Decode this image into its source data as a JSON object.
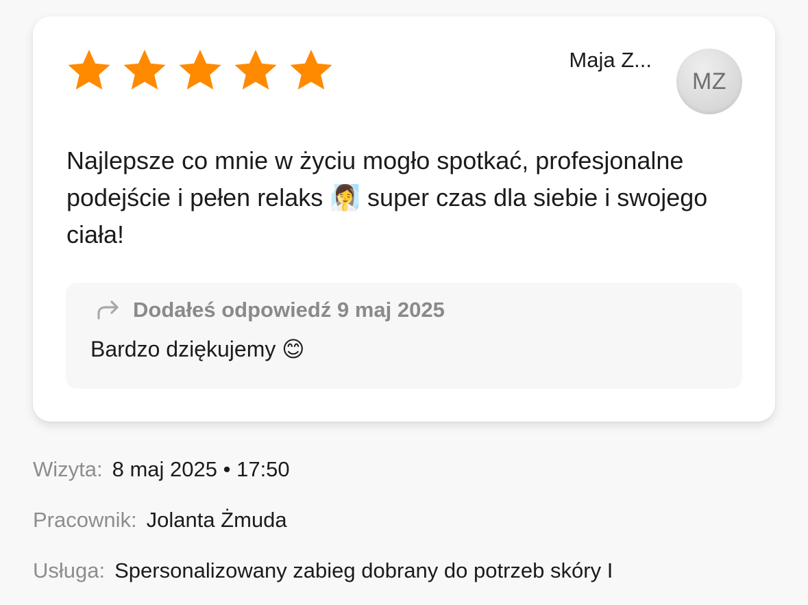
{
  "review": {
    "rating": 5,
    "rating_max": 5,
    "star_color": "#ff8a00",
    "author": "Maja Z...",
    "avatar_initials": "MZ",
    "text": "Najlepsze co mnie w życiu mogło spotkać, profesjonalne podejście i pełen relaks 🧖‍♀️ super czas dla siebie i swojego ciała!"
  },
  "reply": {
    "icon": "reply-arrow-icon",
    "meta": "Dodałeś odpowiedź 9 maj 2025",
    "text": "Bardzo dziękujemy 😊"
  },
  "details": [
    {
      "label": "Wizyta:",
      "value": "8 maj 2025 • 17:50"
    },
    {
      "label": "Pracownik:",
      "value": "Jolanta Żmuda"
    },
    {
      "label": "Usługa:",
      "value": "Spersonalizowany zabieg dobrany do potrzeb skóry I"
    }
  ]
}
